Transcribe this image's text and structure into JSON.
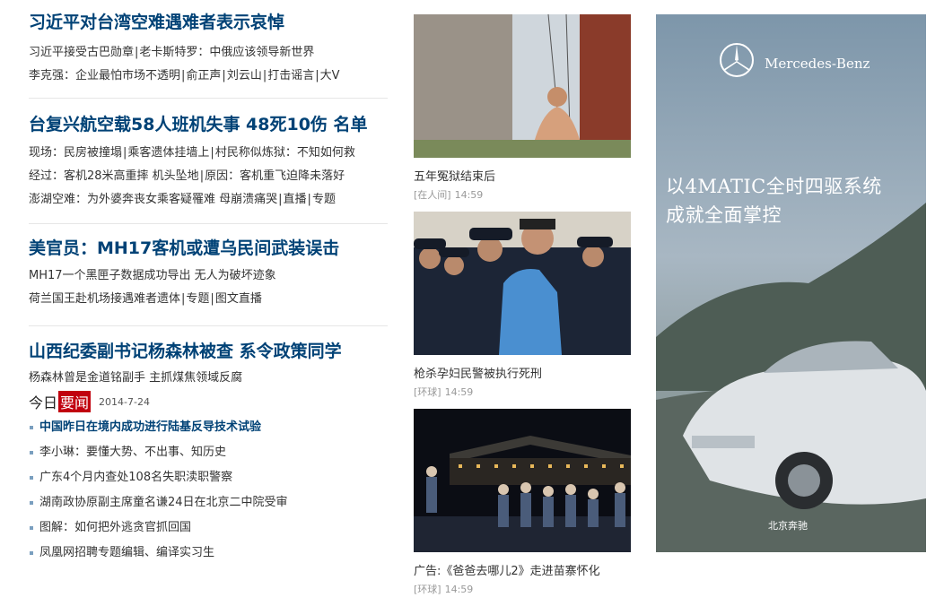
{
  "news_blocks": [
    {
      "headline": "习近平对台湾空难遇难者表示哀悼",
      "lines": [
        [
          "习近平接受古巴勋章",
          "老卡斯特罗：中俄应该领导新世界"
        ],
        [
          "李克强：企业最怕市场不透明",
          "俞正声",
          "刘云山",
          "打击谣言",
          "大V"
        ]
      ]
    },
    {
      "headline": "台复兴航空载58人班机失事 48死10伤 名单",
      "lines": [
        [
          "现场：民房被撞塌",
          "乘客遗体挂墙上",
          "村民称似炼狱：不知如何救"
        ],
        [
          "经过：客机28米高重摔 机头坠地",
          "原因：客机重飞迫降未落好"
        ],
        [
          "澎湖空难：为外婆奔丧女乘客疑罹难 母崩溃痛哭",
          "直播",
          "专题"
        ]
      ]
    },
    {
      "headline": "美官员：MH17客机或遭乌民间武装误击",
      "lines": [
        [
          "MH17一个黑匣子数据成功导出 无人为破坏迹象"
        ],
        [
          "荷兰国王赴机场接遇难者遗体",
          "专题",
          "图文直播"
        ]
      ]
    },
    {
      "headline": "山西纪委副书记杨森林被查 系令政策同学",
      "lines": [
        [
          "杨森林曾是金道铭副手 主抓煤焦领域反腐"
        ]
      ]
    }
  ],
  "today": {
    "label_a": "今日",
    "label_b": "要闻",
    "date": "2014-7-24",
    "items": [
      "中国昨日在境内成功进行陆基反导技术试验",
      "李小琳：要懂大势、不出事、知历史",
      "广东4个月内查处108名失职渎职警察",
      "湖南政协原副主席童名谦24日在北京二中院受审",
      "图解：如何把外逃贪官抓回国",
      "凤凰网招聘专题编辑、编译实习生"
    ]
  },
  "photos": [
    {
      "caption": "五年冤狱结束后",
      "source": "[在人间]",
      "time": "14:59"
    },
    {
      "caption": "枪杀孕妇民警被执行死刑",
      "source": "[环球]",
      "time": "14:59"
    },
    {
      "caption": "广告:《爸爸去哪儿2》走进苗寨怀化",
      "source": "[环球]",
      "time": "14:59"
    }
  ],
  "ad": {
    "brand": "Mercedes-Benz",
    "slogan_line1": "以4MATIC全时四驱系统",
    "slogan_line2": "成就全面掌控",
    "dealer": "北京奔驰"
  },
  "colors": {
    "headline": "#004276",
    "today_badge": "#c1000e"
  }
}
